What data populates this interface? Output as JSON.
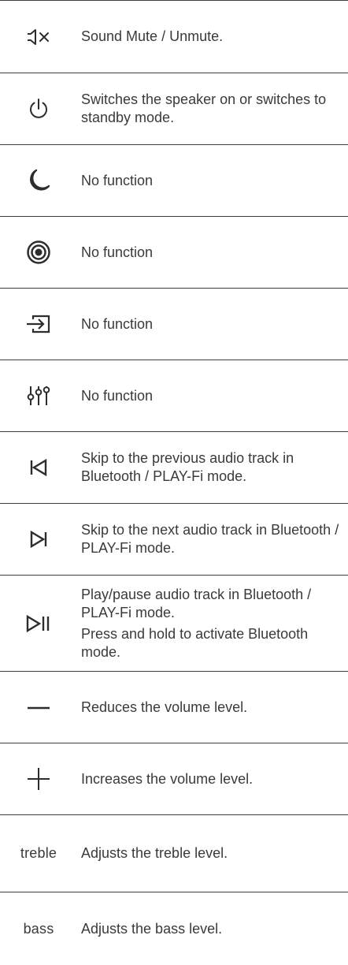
{
  "rows": [
    {
      "icon": "mute-icon",
      "lines": [
        "Sound Mute / Unmute."
      ]
    },
    {
      "icon": "power-icon",
      "lines": [
        "Switches the speaker on or switches to standby mode."
      ]
    },
    {
      "icon": "moon-icon",
      "lines": [
        "No function"
      ]
    },
    {
      "icon": "target-icon",
      "lines": [
        "No function"
      ]
    },
    {
      "icon": "input-icon",
      "lines": [
        "No function"
      ]
    },
    {
      "icon": "equalizer-icon",
      "lines": [
        "No function"
      ]
    },
    {
      "icon": "skip-previous-icon",
      "lines": [
        "Skip to the previous audio track in Bluetooth / PLAY-Fi mode."
      ]
    },
    {
      "icon": "skip-next-icon",
      "lines": [
        "Skip to the next audio track in Bluetooth / PLAY-Fi mode."
      ]
    },
    {
      "icon": "play-pause-icon",
      "lines": [
        "Play/pause audio track in Bluetooth / PLAY-Fi mode.",
        "Press and hold to activate Bluetooth mode."
      ]
    },
    {
      "icon": "minus-icon",
      "lines": [
        "Reduces the volume level."
      ]
    },
    {
      "icon": "plus-icon",
      "lines": [
        "Increases the volume level."
      ]
    },
    {
      "icon_text": "treble",
      "lines": [
        "Adjusts the treble level."
      ]
    },
    {
      "icon_text": "bass",
      "lines": [
        "Adjusts the bass level."
      ]
    }
  ]
}
